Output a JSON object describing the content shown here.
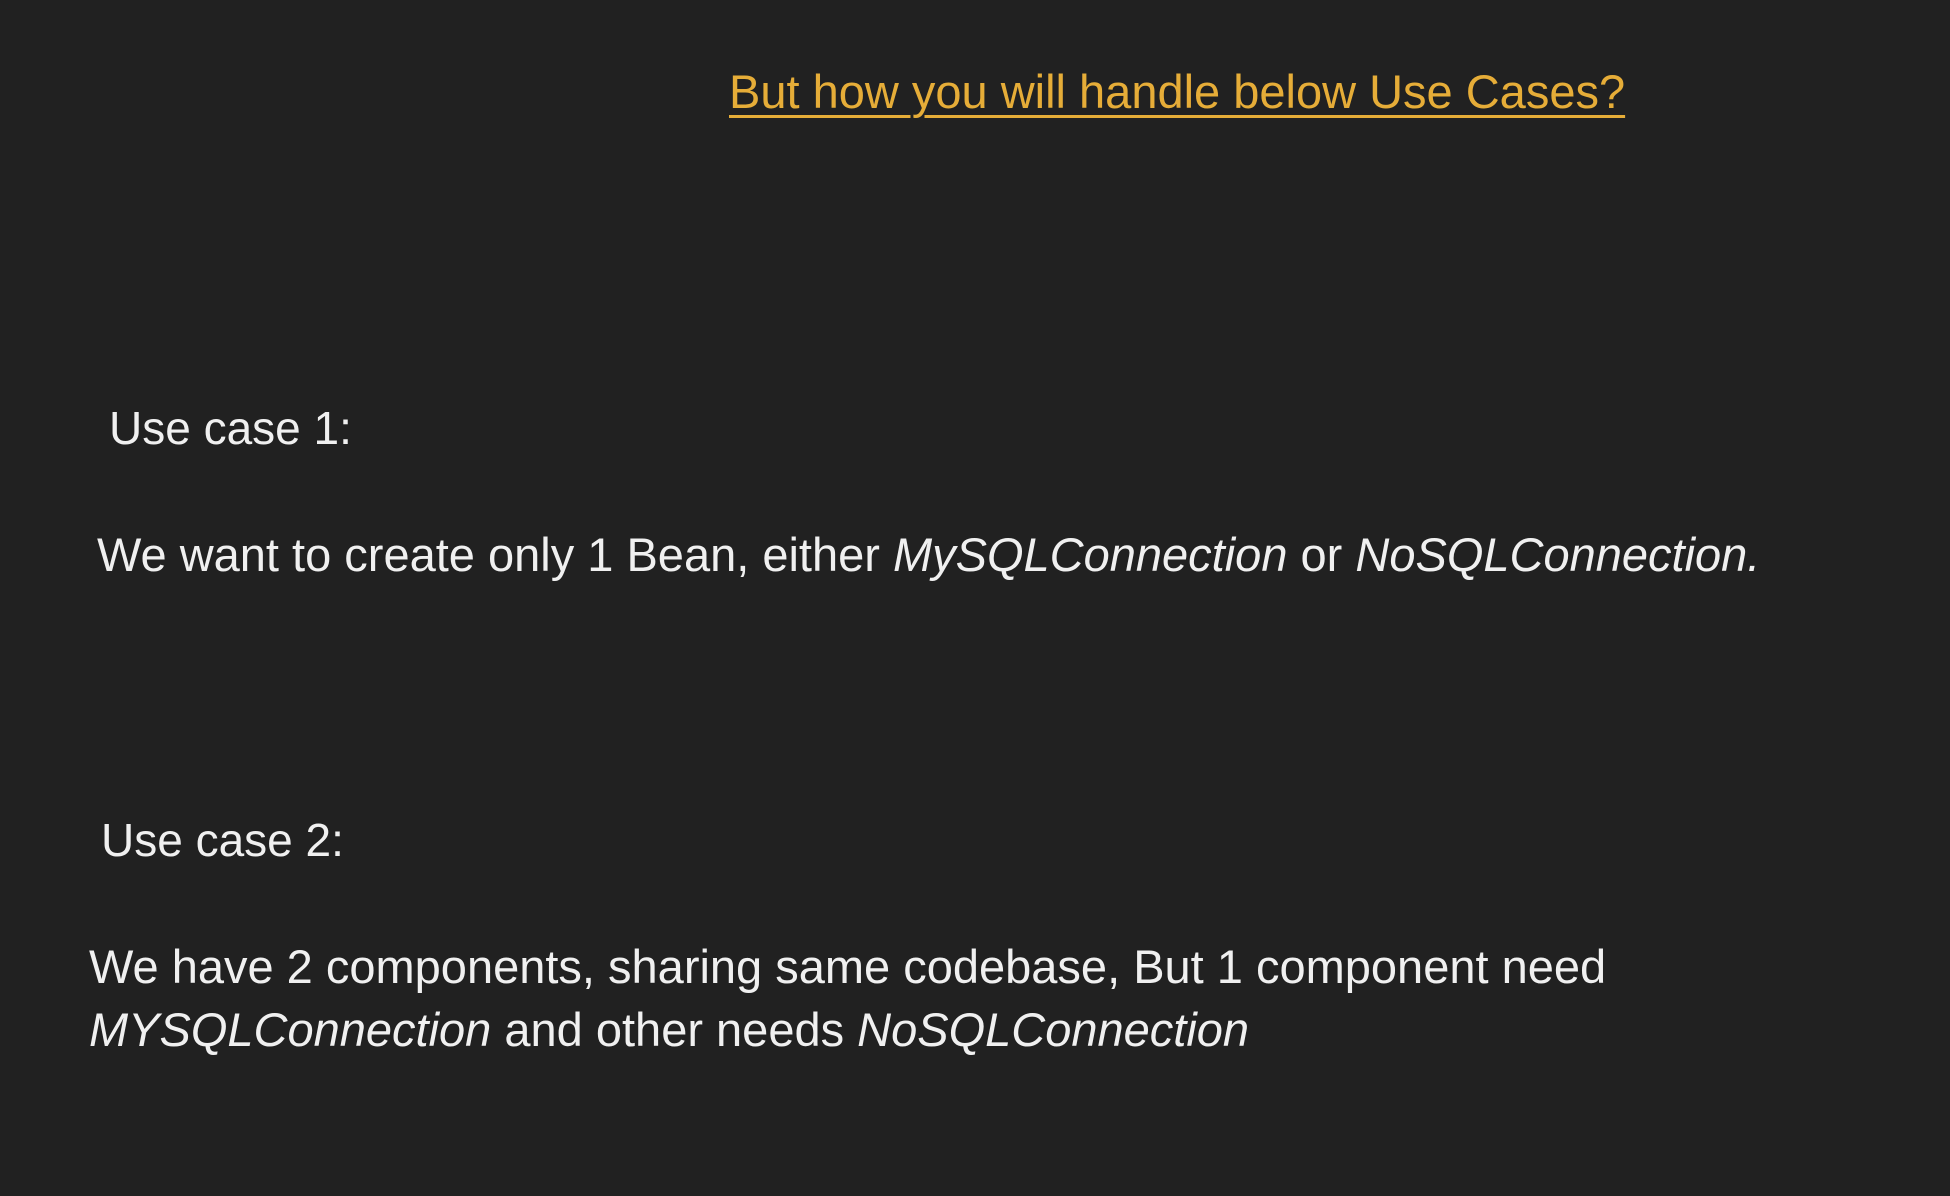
{
  "slide": {
    "title": "But how you will handle below Use Cases?",
    "use_case_1": {
      "heading": "Use case 1:",
      "text_part1": "We want to create only 1 Bean, either ",
      "italic1": "MySQLConnection",
      "text_part2": " or ",
      "italic2": "NoSQLConnection."
    },
    "use_case_2": {
      "heading": "Use case 2:",
      "line1": "We have 2 components, sharing same codebase, But 1 component need",
      "italic1": "MYSQLConnection",
      "text_part2": " and other needs ",
      "italic2": "NoSQLConnection"
    },
    "colors": {
      "background": "#212121",
      "title": "#e6ad38",
      "text": "#f0f0f0"
    }
  }
}
